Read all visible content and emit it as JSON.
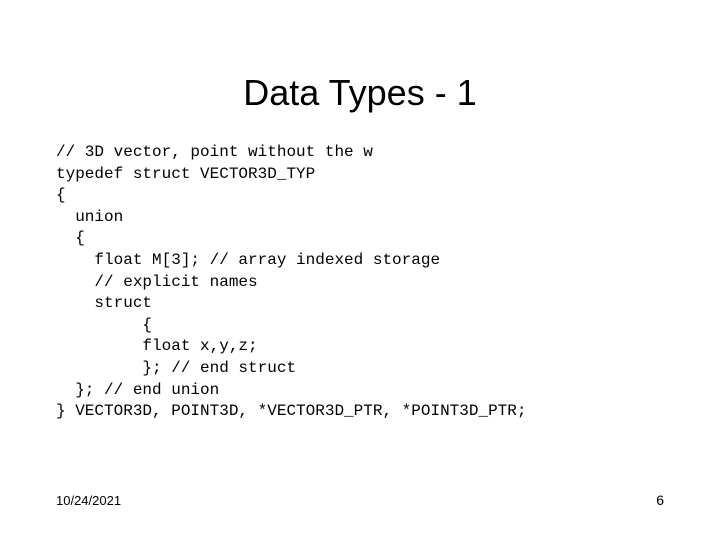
{
  "title": "Data Types - 1",
  "code": {
    "line1": "// 3D vector, point without the w",
    "line2": "typedef struct VECTOR3D_TYP",
    "line3": "{",
    "line4": "  union",
    "line5": "  {",
    "line6": "    float M[3]; // array indexed storage",
    "line7": "    // explicit names",
    "line8": "    struct",
    "line9": "         {",
    "line10": "         float x,y,z;",
    "line11": "         }; // end struct",
    "line12": "  }; // end union",
    "line13": "} VECTOR3D, POINT3D, *VECTOR3D_PTR, *POINT3D_PTR;"
  },
  "footer": {
    "date": "10/24/2021",
    "page": "6"
  }
}
